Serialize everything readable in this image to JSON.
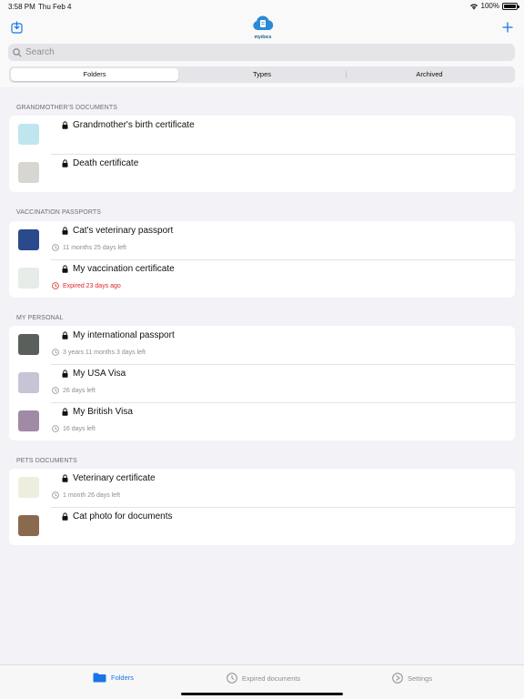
{
  "status": {
    "time": "3:58 PM",
    "date": "Thu Feb 4",
    "battery": "100%"
  },
  "header": {
    "logo_text": "mydocs"
  },
  "search": {
    "placeholder": "Search"
  },
  "segments": [
    "Folders",
    "Types",
    "Archived"
  ],
  "sections": [
    {
      "title": "GRANDMOTHER'S DOCUMENTS",
      "items": [
        {
          "title": "Grandmother's birth certificate",
          "subtitle": "",
          "thumb": "#bfe6ee"
        },
        {
          "title": "Death certificate",
          "subtitle": "",
          "thumb": "#d8d6d0"
        }
      ]
    },
    {
      "title": "VACCINATION PASSPORTS",
      "items": [
        {
          "title": "Cat's veterinary passport",
          "subtitle": "11 months  25 days left",
          "thumb": "#2b4a8c"
        },
        {
          "title": "My vaccination certificate",
          "subtitle": "Expired 23 days ago",
          "expired": true,
          "thumb": "#e7ece8"
        }
      ]
    },
    {
      "title": "MY PERSONAL",
      "items": [
        {
          "title": "My international passport",
          "subtitle": "3 years  11 months  3 days left",
          "thumb": "#5a5f5c"
        },
        {
          "title": "My USA Visa",
          "subtitle": "26 days left",
          "thumb": "#c8c4d6"
        },
        {
          "title": "My British Visa",
          "subtitle": "16 days left",
          "thumb": "#a08aa6"
        }
      ]
    },
    {
      "title": "PETS DOCUMENTS",
      "items": [
        {
          "title": "Veterinary certificate",
          "subtitle": "1 month  26 days left",
          "thumb": "#eeeede"
        },
        {
          "title": "Cat photo for documents",
          "subtitle": "",
          "thumb": "#8a6a4e"
        }
      ]
    }
  ],
  "tabbar": {
    "folders": "Folders",
    "expired": "Expired documents",
    "settings": "Settings"
  },
  "colors": {
    "accent": "#1a73e8",
    "expired": "#e0262a"
  },
  "icons": {
    "download": "download-icon",
    "add": "plus-icon",
    "lock": "lock-icon",
    "clock": "clock-icon"
  }
}
